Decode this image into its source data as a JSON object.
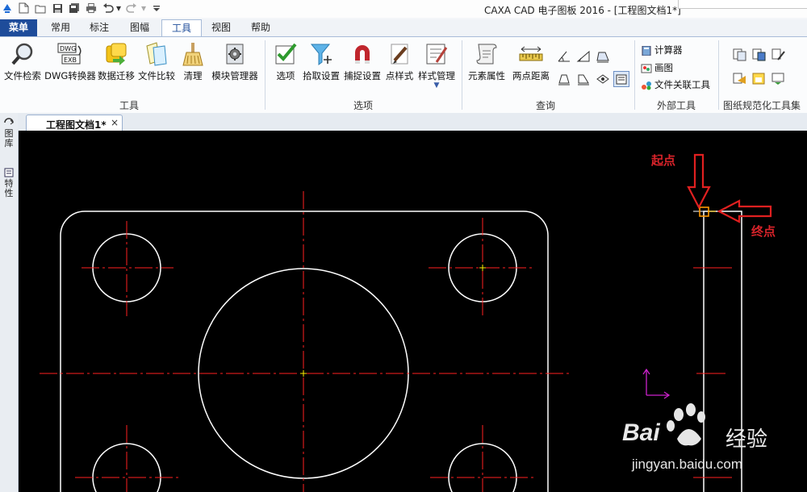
{
  "window": {
    "title": "CAXA CAD 电子图板 2016 - [工程图文档1*]"
  },
  "quick_access": {
    "icons": [
      "app-logo-icon",
      "new-file-icon",
      "open-folder-icon",
      "save-icon",
      "save-all-icon",
      "print-icon",
      "undo-icon",
      "dropdown-icon",
      "redo-icon",
      "dropdown-icon",
      "customize-icon"
    ]
  },
  "tabs": [
    {
      "label": "菜单",
      "state": "menu"
    },
    {
      "label": "常用"
    },
    {
      "label": "标注"
    },
    {
      "label": "图幅"
    },
    {
      "label": "工具",
      "state": "active"
    },
    {
      "label": "视图"
    },
    {
      "label": "帮助"
    }
  ],
  "ribbon": {
    "groups": {
      "tools": {
        "label": "工具"
      },
      "options": {
        "label": "选项"
      },
      "query": {
        "label": "查询"
      },
      "external": {
        "label": "外部工具"
      },
      "drawing_std": {
        "label": "图纸规范化工具集"
      }
    },
    "tools_buttons": [
      {
        "label": "文件检索",
        "icon": "magnifier-icon"
      },
      {
        "label": "DWG转换器",
        "icon": "dwg-exb-converter-icon"
      },
      {
        "label": "数据迁移",
        "icon": "data-migration-icon"
      },
      {
        "label": "文件比较",
        "icon": "file-compare-icon"
      },
      {
        "label": "清理",
        "icon": "broom-icon"
      },
      {
        "label": "模块管理器",
        "icon": "gear-module-icon"
      }
    ],
    "options_buttons": [
      {
        "label": "选项",
        "icon": "checkbox-icon"
      },
      {
        "label": "拾取设置",
        "icon": "pick-filter-icon"
      },
      {
        "label": "捕捉设置",
        "icon": "magnet-icon"
      },
      {
        "label": "点样式",
        "icon": "point-style-icon"
      },
      {
        "label": "样式管理",
        "icon": "style-manager-icon"
      }
    ],
    "query_buttons": [
      {
        "label": "元素属性",
        "icon": "element-properties-icon"
      },
      {
        "label": "两点距离",
        "icon": "ruler-icon"
      }
    ],
    "external_items": [
      {
        "label": "计算器",
        "icon": "calculator-icon"
      },
      {
        "label": "画图",
        "icon": "paint-icon"
      },
      {
        "label": "文件关联工具",
        "icon": "file-association-icon"
      }
    ]
  },
  "document": {
    "tab_label": "工程图文档1*",
    "close": "×"
  },
  "side_panel": {
    "tabs": [
      "图库",
      "特性"
    ]
  },
  "canvas": {
    "annotations": {
      "start": "起点",
      "end": "终点"
    },
    "watermark": {
      "brand": "Bai",
      "brand2": "经验",
      "url": "jingyan.baidu.com"
    }
  },
  "colors": {
    "background": "#000000",
    "geometry": "#ffffff",
    "centerline": "#ff0000",
    "annotation": "#d8232a",
    "snap_marker": "#ff9900",
    "ucs_axis": "#cc00cc",
    "accent": "#1e4c9a"
  }
}
